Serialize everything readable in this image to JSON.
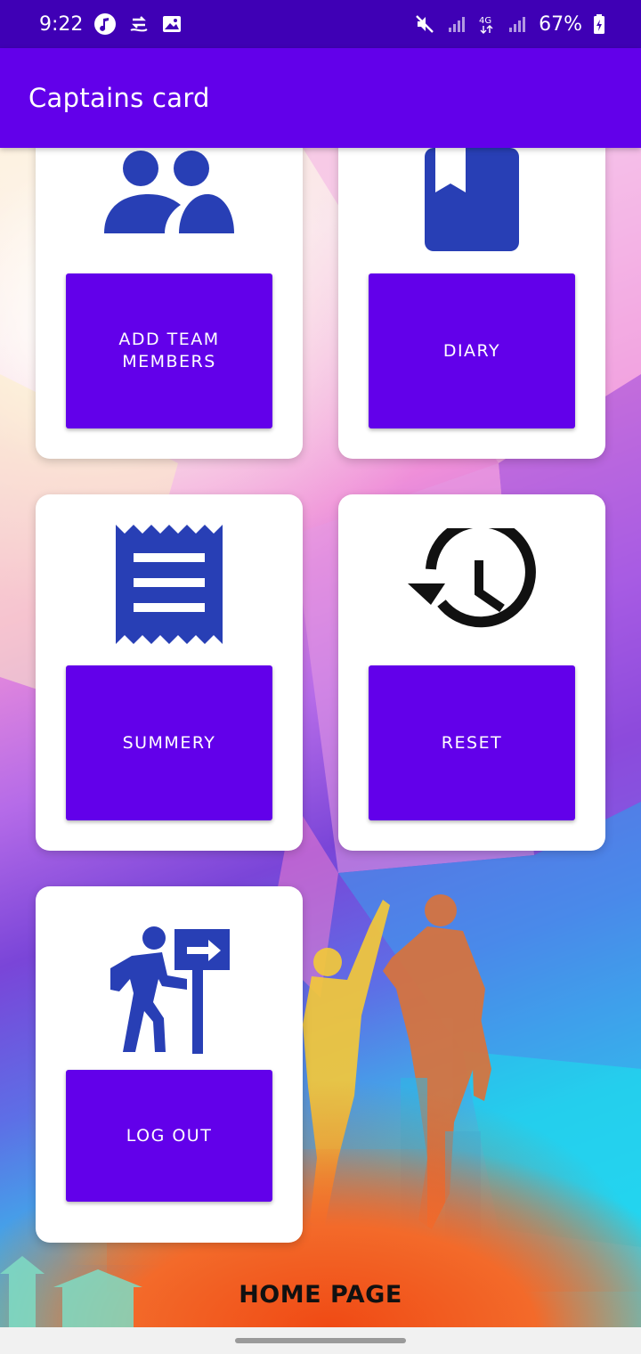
{
  "status_bar": {
    "time": "9:22",
    "battery": "67%",
    "icons": [
      "music-note-icon",
      "data-transfer-icon",
      "gallery-icon",
      "mute-icon",
      "signal-icon",
      "4g-icon",
      "signal-icon-2",
      "battery-icon"
    ]
  },
  "app_bar": {
    "title": "Captains card"
  },
  "cards": {
    "team": {
      "label": "ADD TEAM\nMEMBERS",
      "icon": "group-icon"
    },
    "diary": {
      "label": "DIARY",
      "icon": "book-icon"
    },
    "summery": {
      "label": "SUMMERY",
      "icon": "receipt-icon"
    },
    "reset": {
      "label": "RESET",
      "icon": "history-icon"
    },
    "logout": {
      "label": "LOG OUT",
      "icon": "exit-signpost-icon"
    }
  },
  "footer": {
    "label": "HOME PAGE"
  },
  "colors": {
    "status_bar": "#3f00b5",
    "app_bar": "#6200ea",
    "button": "#6200ea",
    "icon_blue": "#283fb5"
  }
}
